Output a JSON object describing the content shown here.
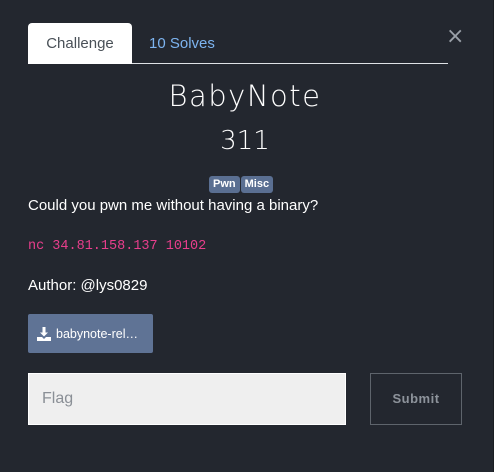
{
  "tabs": [
    {
      "label": "Challenge",
      "active": true
    },
    {
      "label": "10 Solves",
      "active": false
    }
  ],
  "close_icon": "close-icon",
  "challenge": {
    "name": "BabyNote",
    "value": "311",
    "tags": [
      "Pwn",
      "Misc"
    ],
    "description": "Could you pwn me without having a binary?",
    "connection": "nc 34.81.158.137 10102",
    "author": "Author: @lys0829"
  },
  "files": [
    {
      "label": "babynote-rel…",
      "icon": "download-icon"
    }
  ],
  "flag_form": {
    "placeholder": "Flag",
    "value": "",
    "submit_label": "Submit"
  },
  "colors": {
    "background": "#23272f",
    "tag": "#5a6f92",
    "file_button": "#5f7395",
    "code": "#e83e8c",
    "tab_link": "#7db4f0"
  }
}
